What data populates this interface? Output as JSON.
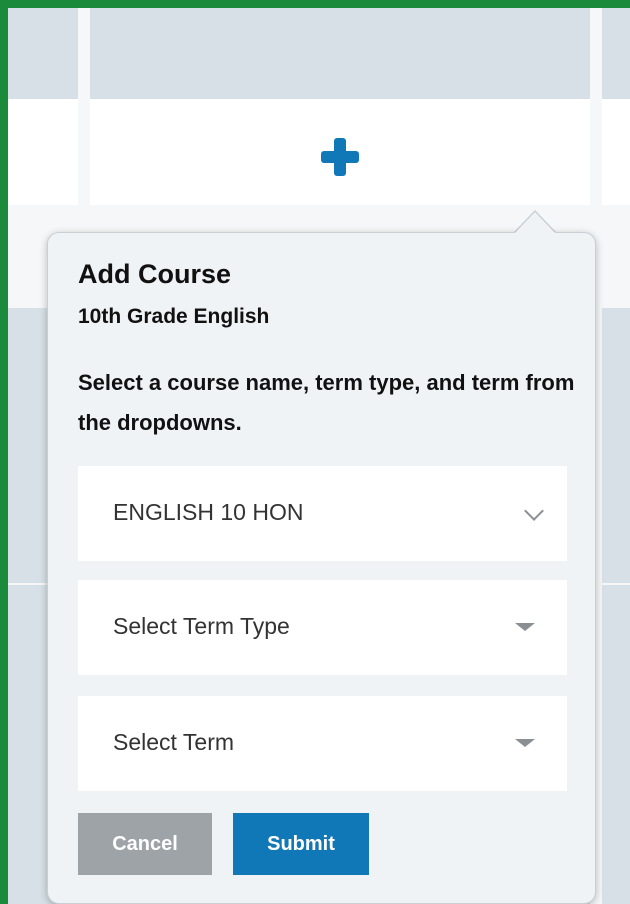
{
  "popover": {
    "title": "Add Course",
    "subtitle": "10th Grade English",
    "instruction": "Select a course name, term type, and term from the dropdowns.",
    "course_select": {
      "value": "ENGLISH 10 HON",
      "icon": "chevron-down-icon"
    },
    "term_type_select": {
      "placeholder": "Select Term Type",
      "icon": "caret-down-icon"
    },
    "term_select": {
      "placeholder": "Select Term",
      "icon": "caret-down-icon"
    },
    "cancel_label": "Cancel",
    "submit_label": "Submit"
  },
  "grid": {
    "add_icon": "plus-icon"
  },
  "colors": {
    "accent": "#1178b8",
    "cancel": "#9ea3a8",
    "frame": "#1c8a3b",
    "grid_cell": "#d6e0e6"
  }
}
